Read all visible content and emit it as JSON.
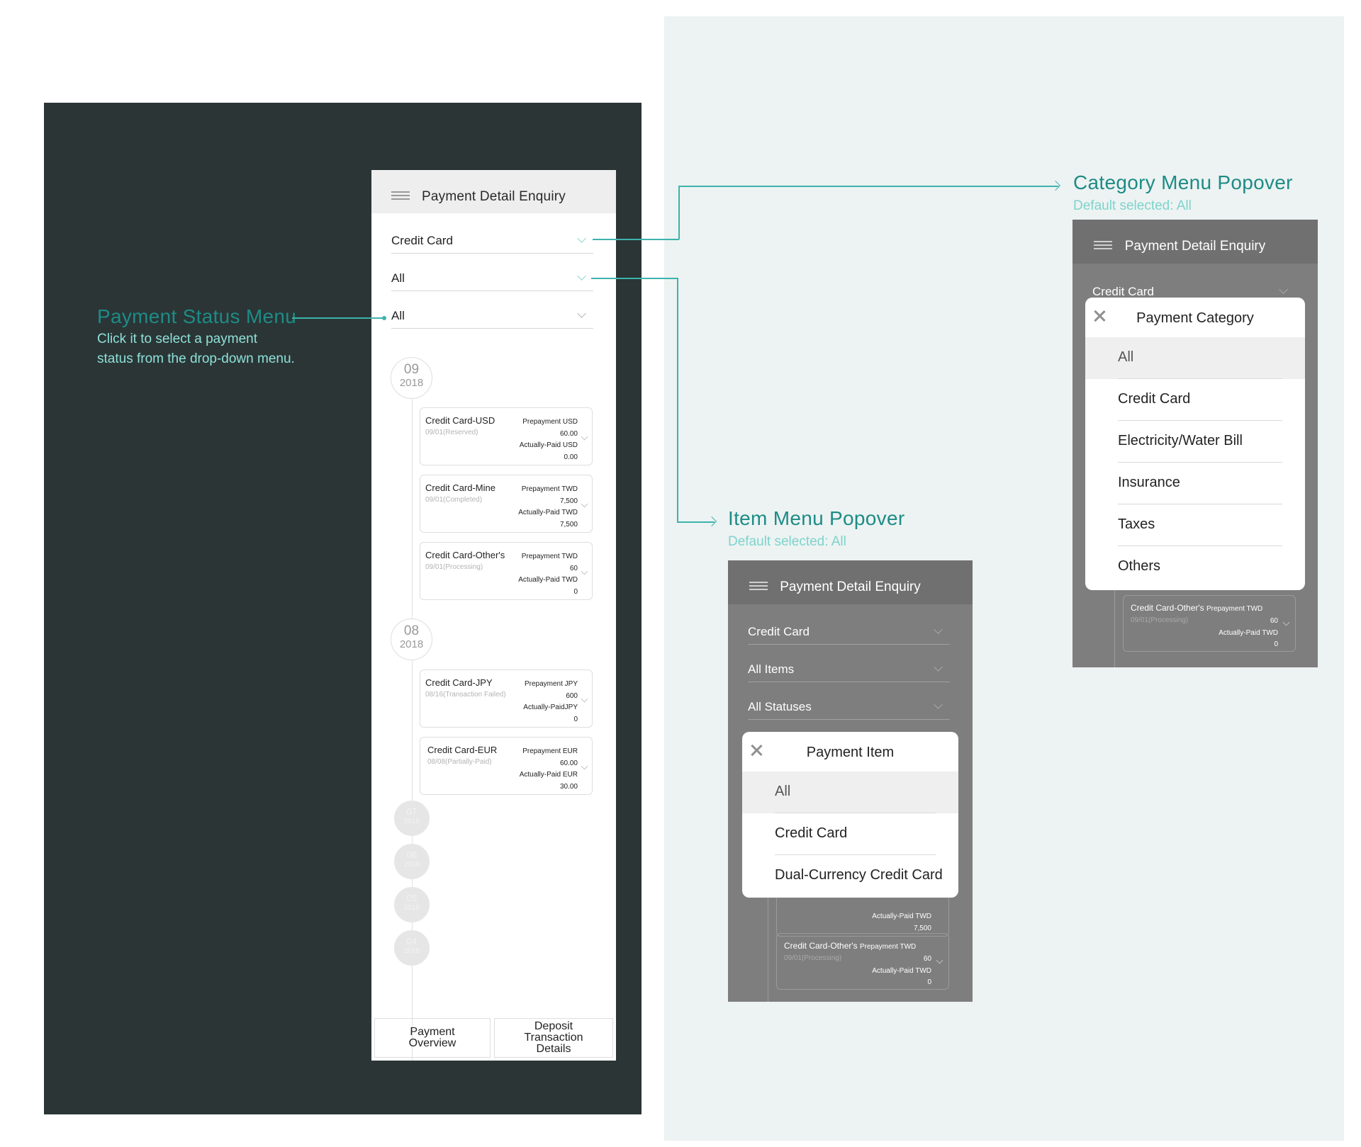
{
  "main_phone": {
    "title": "Payment Detail Enquiry",
    "filters": [
      {
        "value": "Credit Card"
      },
      {
        "value": "All"
      },
      {
        "value": "All"
      }
    ],
    "months": [
      {
        "month": "09",
        "year": "2018"
      },
      {
        "month": "08",
        "year": "2018"
      },
      {
        "month": "07",
        "year": "2018"
      },
      {
        "month": "06",
        "year": "2018"
      },
      {
        "month": "05",
        "year": "2018"
      },
      {
        "month": "04",
        "year": "2018"
      }
    ],
    "records": [
      {
        "name": "Credit Card-USD",
        "sub": "09/01(Reserved)",
        "prepay": "Prepayment USD",
        "prepay_amt": "60.00",
        "paid": "Actually-Paid USD",
        "paid_amt": "0.00"
      },
      {
        "name": "Credit Card-Mine",
        "sub": "09/01(Completed)",
        "prepay": "Prepayment TWD",
        "prepay_amt": "7,500",
        "paid": "Actually-Paid TWD",
        "paid_amt": "7,500"
      },
      {
        "name": "Credit Card-Other's",
        "sub": "09/01(Processing)",
        "prepay": "Prepayment TWD",
        "prepay_amt": "60",
        "paid": "Actually-Paid TWD",
        "paid_amt": "0"
      },
      {
        "name": "Credit Card-JPY",
        "sub": "08/16(Transaction Failed)",
        "prepay": "Prepayment JPY",
        "prepay_amt": "600",
        "paid": "Actually-PaidJPY",
        "paid_amt": "0"
      },
      {
        "name": "Credit Card-EUR",
        "sub": "08/08(Partially-Paid)",
        "prepay": "Prepayment EUR",
        "prepay_amt": "60.00",
        "paid": "Actually-Paid EUR",
        "paid_amt": "30.00"
      }
    ],
    "tabs": {
      "overview": "Payment Overview",
      "deposit": "Deposit Transaction Details"
    }
  },
  "annotations": {
    "status_menu": {
      "title": "Payment Status Menu",
      "desc": "Click it to select a payment status from the  drop-down menu."
    },
    "category_popover": {
      "title": "Category Menu Popover",
      "sub": "Default selected: All"
    },
    "item_popover": {
      "title": "Item Menu Popover",
      "sub": "Default selected: All"
    }
  },
  "category_phone": {
    "title": "Payment Detail Enquiry",
    "field": "Credit Card",
    "card": {
      "name": "Credit Card-Other's",
      "prepay": "Prepayment TWD",
      "sub": "09/01(Processing)",
      "prepay_amt": "60",
      "paid": "Actually-Paid TWD",
      "paid_amt": "0"
    },
    "popover": {
      "title": "Payment Category",
      "options": [
        "All",
        "Credit Card",
        "Electricity/Water Bill",
        "Insurance",
        "Taxes",
        "Others"
      ]
    }
  },
  "item_phone": {
    "title": "Payment Detail Enquiry",
    "fields": [
      "Credit Card",
      "All Items",
      "All Statuses"
    ],
    "card_partial": {
      "paid": "Actually-Paid TWD",
      "paid_amt": "7,500"
    },
    "card": {
      "name": "Credit Card-Other's",
      "prepay": "Prepayment TWD",
      "sub": "09/01(Processing)",
      "prepay_amt": "60",
      "paid": "Actually-Paid TWD",
      "paid_amt": "0"
    },
    "popover": {
      "title": "Payment Item",
      "options": [
        "All",
        "Credit Card",
        "Dual-Currency Credit Card"
      ]
    }
  },
  "colors": {
    "dark_bg": "#2b3536",
    "light_bg": "#ecf3f2",
    "accent": "#3db3ac",
    "annotation_title": "#1e8b86"
  }
}
